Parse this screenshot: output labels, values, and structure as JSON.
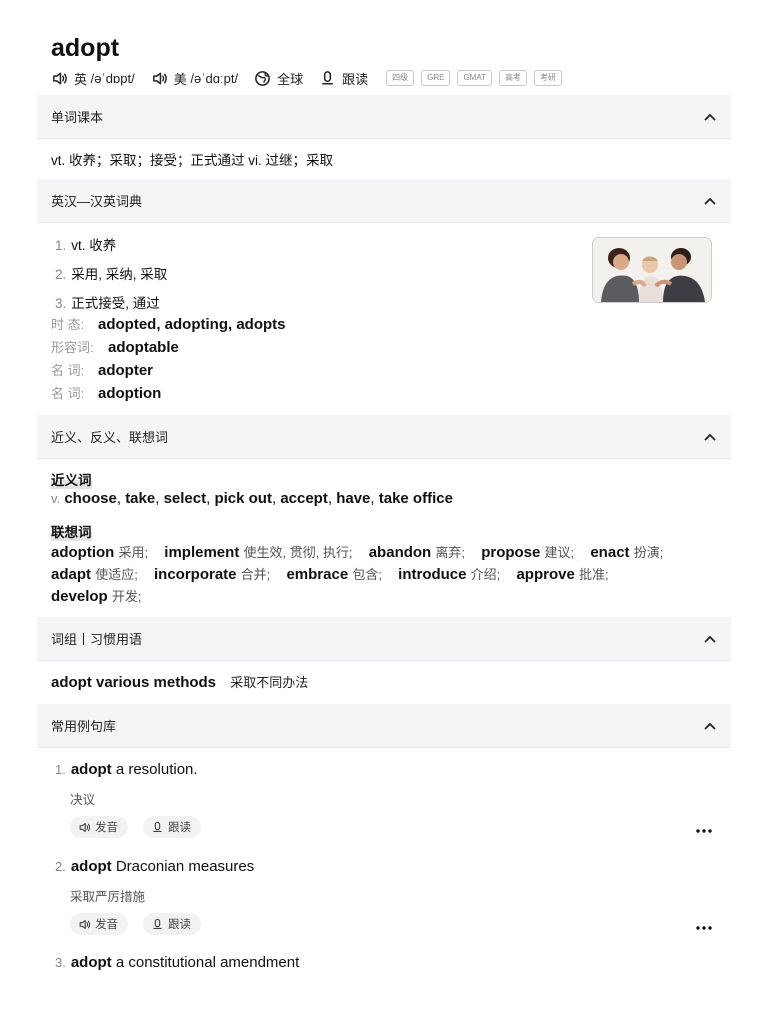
{
  "word": "adopt",
  "phonetics": [
    {
      "region": "英",
      "ipa": "/əˈdɒpt/"
    },
    {
      "region": "美",
      "ipa": "/əˈdɑːpt/"
    }
  ],
  "global_label": "全球",
  "follow_label": "跟读",
  "tags": [
    "四级",
    "GRE",
    "GMAT",
    "高考",
    "考研"
  ],
  "sections": {
    "textbook": "单词课本",
    "ec": "英汉—汉英词典",
    "synonyms": "近义、反义、联想词",
    "phrases": "词组丨习惯用语",
    "examples": "常用例句库"
  },
  "basic_def": "vt. 收养；采取；接受；正式通过 vi. 过继；采取",
  "definitions": [
    {
      "n": "1.",
      "text": "vt. 收养"
    },
    {
      "n": "2.",
      "text": "采用, 采纳, 采取"
    },
    {
      "n": "3.",
      "text": "正式接受, 通过"
    }
  ],
  "forms": [
    {
      "label": "时 态:",
      "value": "adopted, adopting, adopts"
    },
    {
      "label": "形容词:",
      "value": "adoptable"
    },
    {
      "label": "名 词:",
      "value": "adopter"
    },
    {
      "label": "名 词:",
      "value": "adoption"
    }
  ],
  "synonym_title": "近义词",
  "synonym_pos": "v.",
  "synonyms": [
    "choose",
    "take",
    "select",
    "pick out",
    "accept",
    "have",
    "take office"
  ],
  "assoc_title": "联想词",
  "assoc": [
    {
      "w": "adoption",
      "m": "采用;"
    },
    {
      "w": "implement",
      "m": "使生效, 贯彻, 执行;"
    },
    {
      "w": "abandon",
      "m": "离弃;"
    },
    {
      "w": "propose",
      "m": "建议;"
    },
    {
      "w": "enact",
      "m": "扮演;"
    },
    {
      "w": "adapt",
      "m": "使适应;"
    },
    {
      "w": "incorporate",
      "m": "合并;"
    },
    {
      "w": "embrace",
      "m": "包含;"
    },
    {
      "w": "introduce",
      "m": "介绍;"
    },
    {
      "w": "approve",
      "m": "批准;"
    },
    {
      "w": "develop",
      "m": "开发;"
    }
  ],
  "phrase": {
    "en": "adopt various methods",
    "zh": "采取不同办法"
  },
  "examples": [
    {
      "n": "1.",
      "kw": "adopt",
      "rest": " a resolution.",
      "zh": "决议"
    },
    {
      "n": "2.",
      "kw": "adopt",
      "rest": " Draconian measures",
      "zh": "采取严厉措施"
    },
    {
      "n": "3.",
      "kw": "adopt",
      "rest": " a constitutional amendment",
      "zh": ""
    }
  ],
  "pill_speak": "发音",
  "pill_follow": "跟读",
  "colors": {
    "section_bg": "#f4f5f7",
    "text": "#111111",
    "muted": "#888888"
  }
}
